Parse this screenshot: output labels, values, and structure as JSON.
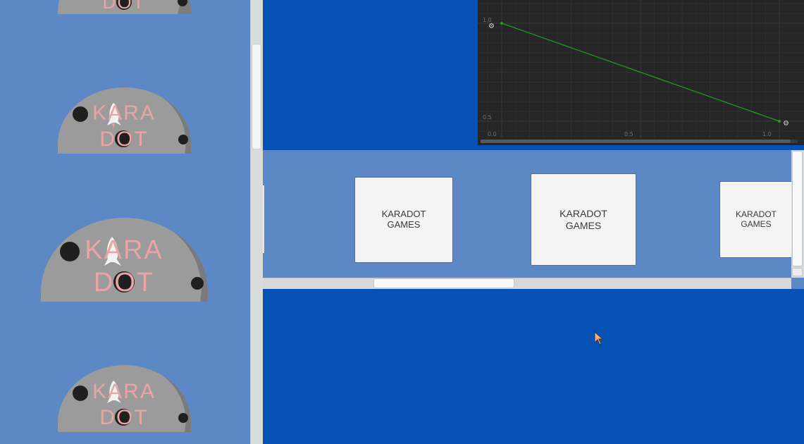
{
  "colors": {
    "background": "#0551b6",
    "panel": "#5c89c6",
    "logo_dome": "#9b9b9b",
    "logo_text": "#e9a4a6",
    "curve_bg": "#262626",
    "curve_line": "#1fa01f",
    "card_bg": "#f4f4f5"
  },
  "logos": [
    {
      "line1": "KARA",
      "line2": "DOT"
    },
    {
      "line1": "KARA",
      "line2": "DOT"
    },
    {
      "line1": "KARA",
      "line2": "DOT"
    },
    {
      "line1": "KARA",
      "line2": "DOT"
    }
  ],
  "curve_editor": {
    "y_ticks": [
      "1.0",
      "0.5"
    ],
    "x_ticks": [
      "0.0",
      "0.5",
      "1.0"
    ],
    "keyframe_icon": "gear-icon",
    "keyframes": [
      {
        "time": 0.0,
        "value": 1.0
      },
      {
        "time": 1.0,
        "value": 0.5
      }
    ]
  },
  "cards": [
    {
      "line1": "KARADOT",
      "line2": "GAMES"
    },
    {
      "line1": "KARADOT",
      "line2": "GAMES"
    },
    {
      "line1": "KARADOT",
      "line2": "GAMES"
    }
  ]
}
